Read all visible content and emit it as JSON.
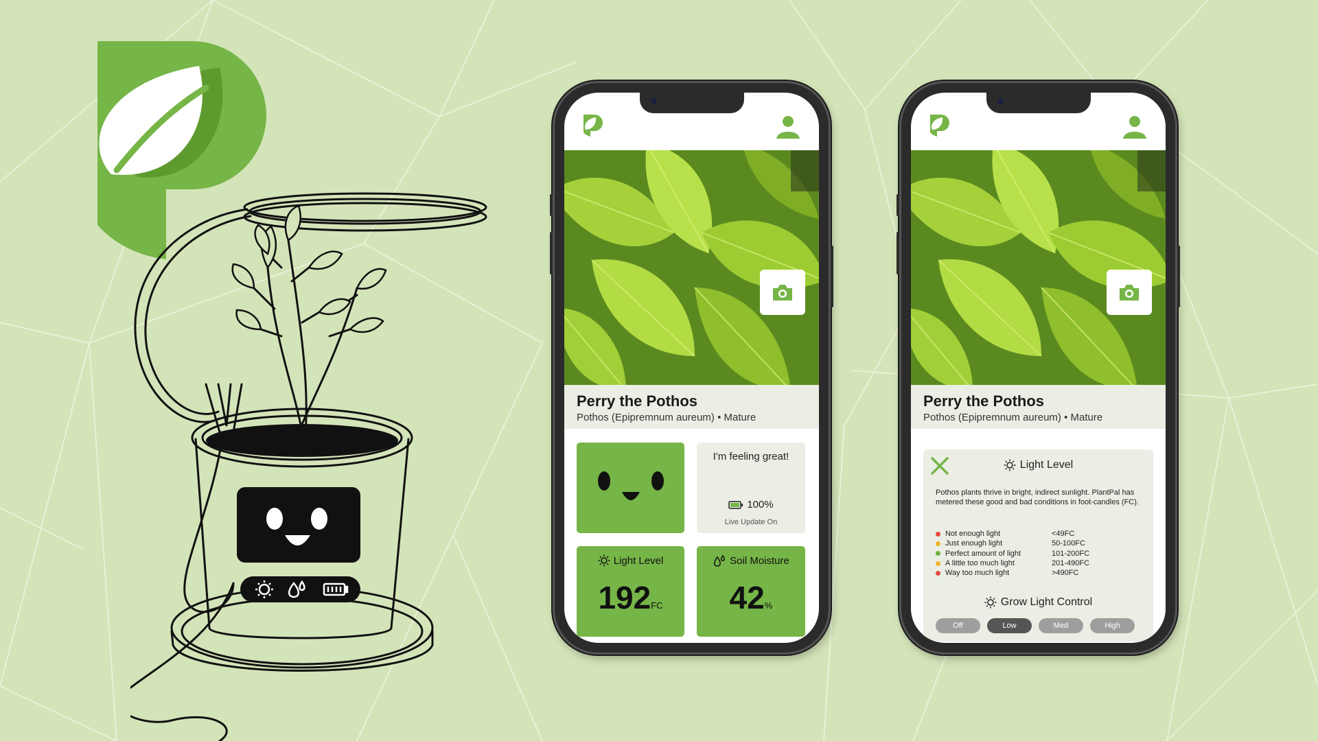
{
  "brand": {
    "logo_icon": "plantpal-p-leaf-logo",
    "primary_color": "#76b547",
    "background_color": "#d4e4b9"
  },
  "illustration": {
    "description_icon": "smart-pot-with-grow-light-ring",
    "status_icons": [
      "sun-icon",
      "water-drops-icon",
      "battery-icon"
    ]
  },
  "plant": {
    "name": "Perry the Pothos",
    "subtitle": "Pothos (Epipremnum aureum) • Mature"
  },
  "dashboard": {
    "mood_text": "I'm feeling great!",
    "battery": "100%",
    "live_update": "Live Update On",
    "light": {
      "label": "Light Level",
      "value": "192",
      "unit": "FC"
    },
    "moisture": {
      "label": "Soil Moisture",
      "value": "42",
      "unit": "%"
    }
  },
  "detail": {
    "title": "Light Level",
    "description": "Pothos plants thrive in bright, indirect sunlight. PlantPal has metered these good and bad conditions in foot-candles (FC).",
    "legend": [
      {
        "label": "Not enough light",
        "range": "<49FC",
        "color": "#e5483b"
      },
      {
        "label": "Just enough light",
        "range": "50-100FC",
        "color": "#f0b429"
      },
      {
        "label": "Perfect amount of light",
        "range": "101-200FC",
        "color": "#6fb33d"
      },
      {
        "label": "A little too much light",
        "range": "201-490FC",
        "color": "#f0b429"
      },
      {
        "label": "Way too much light",
        "range": ">490FC",
        "color": "#e5483b"
      }
    ],
    "control_title": "Grow Light Control",
    "options": [
      "Off",
      "Low",
      "Med",
      "High"
    ],
    "selected_option": "Low"
  }
}
